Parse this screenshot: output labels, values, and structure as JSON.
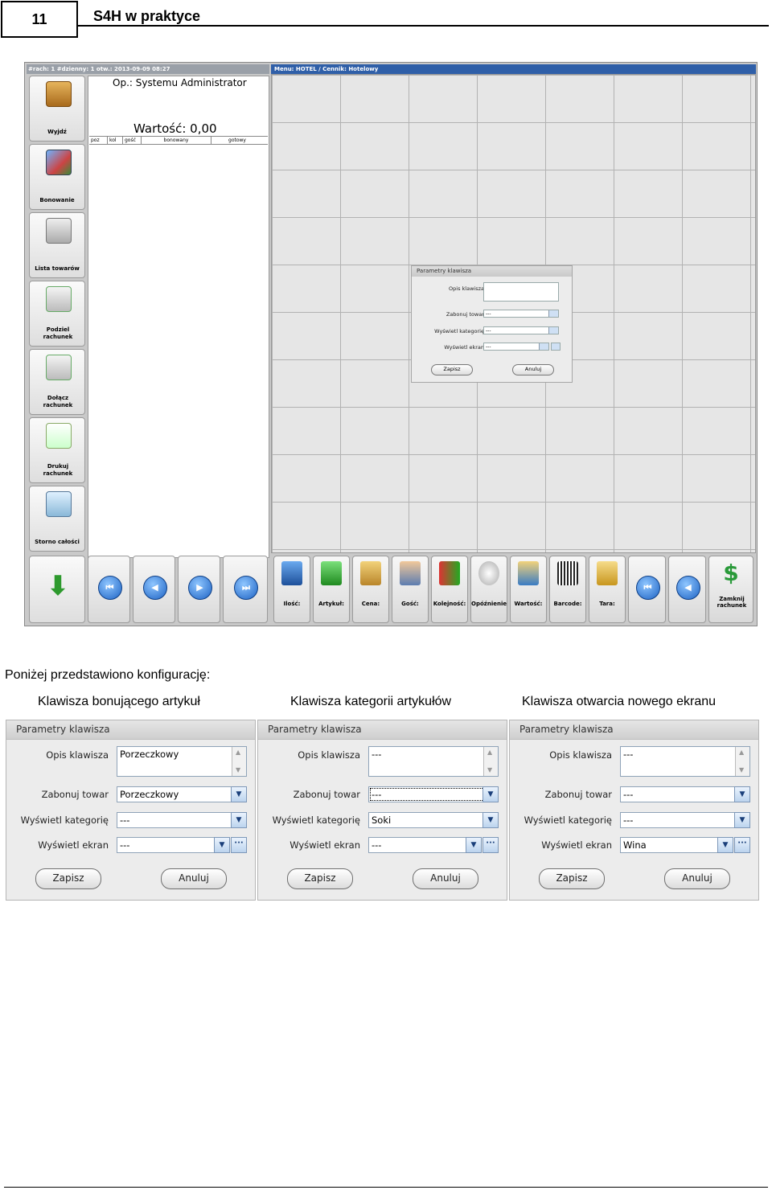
{
  "header": {
    "page_number": "11",
    "title": "S4H w praktyce"
  },
  "screenshot": {
    "left_bar": "#rach: 1 #dzienny: 1 otw.: 2013-09-09 08:27",
    "menu_bar": "Menu: HOTEL / Cennik: Hotelowy",
    "operator": "Op.: Systemu Administrator",
    "value": "Wartość: 0,00",
    "columns": [
      "poz",
      "kol",
      "gość",
      "bonowany",
      "gotowy"
    ],
    "side_buttons": [
      "Wyjdź",
      "Bonowanie",
      "Lista towarów",
      "Podziel rachunek",
      "Dołącz rachunek",
      "Drukuj rachunek",
      "Storno całości"
    ],
    "nav_buttons": [
      "⏮",
      "◀",
      "▶",
      "⏭"
    ],
    "toolbar": [
      "Ilość:",
      "Artykuł:",
      "Cena:",
      "Gość:",
      "Kolejność:",
      "Opóźnienie",
      "Wartość:",
      "Barcode:",
      "Tara:"
    ],
    "close_button": "Zamknij rachunek",
    "mini_dialog": {
      "title": "Parametry klawisza",
      "desc_label": "Opis klawisza",
      "item_label": "Zabonuj towar",
      "cat_label": "Wyświetl kategorię",
      "screen_label": "Wyświetl ekran",
      "item_value": "---",
      "cat_value": "---",
      "screen_value": "---",
      "save": "Zapisz",
      "cancel": "Anuluj"
    }
  },
  "intro": "Poniżej przedstawiono konfigurację:",
  "captions": [
    "Klawisza bonującego artykuł",
    "Klawisza kategorii artykułów",
    "Klawisza otwarcia nowego ekranu"
  ],
  "dialog_labels": {
    "title": "Parametry klawisza",
    "desc": "Opis klawisza",
    "item": "Zabonuj towar",
    "cat": "Wyświetl kategorię",
    "screen": "Wyświetl ekran",
    "save": "Zapisz",
    "cancel": "Anuluj",
    "more": "···"
  },
  "dialogs": [
    {
      "desc": "Porzeczkowy",
      "item": "Porzeczkowy",
      "cat": "---",
      "screen": "---"
    },
    {
      "desc": "---",
      "item": "---",
      "cat": "Soki",
      "screen": "---"
    },
    {
      "desc": "---",
      "item": "---",
      "cat": "---",
      "screen": "Wina"
    }
  ],
  "colors": {
    "menu_bar": "#2f5fa8",
    "field_border": "#8fa3b8",
    "dialog_bg": "#ececec"
  },
  "icons": [
    "door-icon",
    "screen-icon",
    "funnel-icon",
    "split-icon",
    "join-icon",
    "print-icon",
    "trash-icon",
    "down-arrow-icon",
    "dollar-arrow-icon"
  ]
}
